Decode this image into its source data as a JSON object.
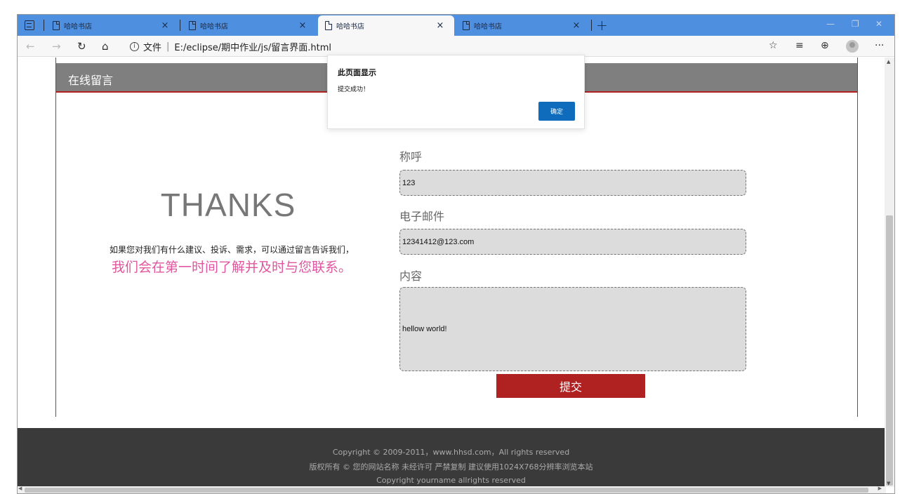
{
  "tabs": [
    {
      "title": "哈哈书店",
      "active": false
    },
    {
      "title": "哈哈书店",
      "active": false
    },
    {
      "title": "哈哈书店",
      "active": true
    },
    {
      "title": "哈哈书店",
      "active": false
    }
  ],
  "toolbar": {
    "file_label": "文件",
    "path": "E:/eclipse/期中作业/js/留言界面.html"
  },
  "page": {
    "header_title": "在线留言",
    "thanks_title": "THANKS",
    "thanks_desc": "如果您对我们有什么建议、投诉、需求，可以通过留言告诉我们，",
    "thanks_pink": "我们会在第一时间了解并及时与您联系。",
    "form": {
      "name_label": "称呼",
      "name_value": "123",
      "email_label": "电子邮件",
      "email_value": "12341412@123.com",
      "content_label": "内容",
      "content_value": "hellow world!",
      "submit_label": "提交"
    },
    "footer": {
      "line1": "Copyright © 2009-2011，www.hhsd.com，All rights reserved",
      "line2": "版权所有 © 您的网站名称 未经许可 严禁复制 建议使用1024X768分辨率浏览本站",
      "line3": "Copyright yourname allrights reserved"
    }
  },
  "dialog": {
    "title": "此页面显示",
    "message": "提交成功！",
    "ok_label": "确定"
  },
  "colors": {
    "tabstrip": "#4f8fe0",
    "header_bg": "#7f7f7f",
    "accent_red": "#b02222",
    "pink_text": "#e0569e",
    "footer_bg": "#3a3a3a",
    "dialog_button": "#0f6cbd"
  }
}
